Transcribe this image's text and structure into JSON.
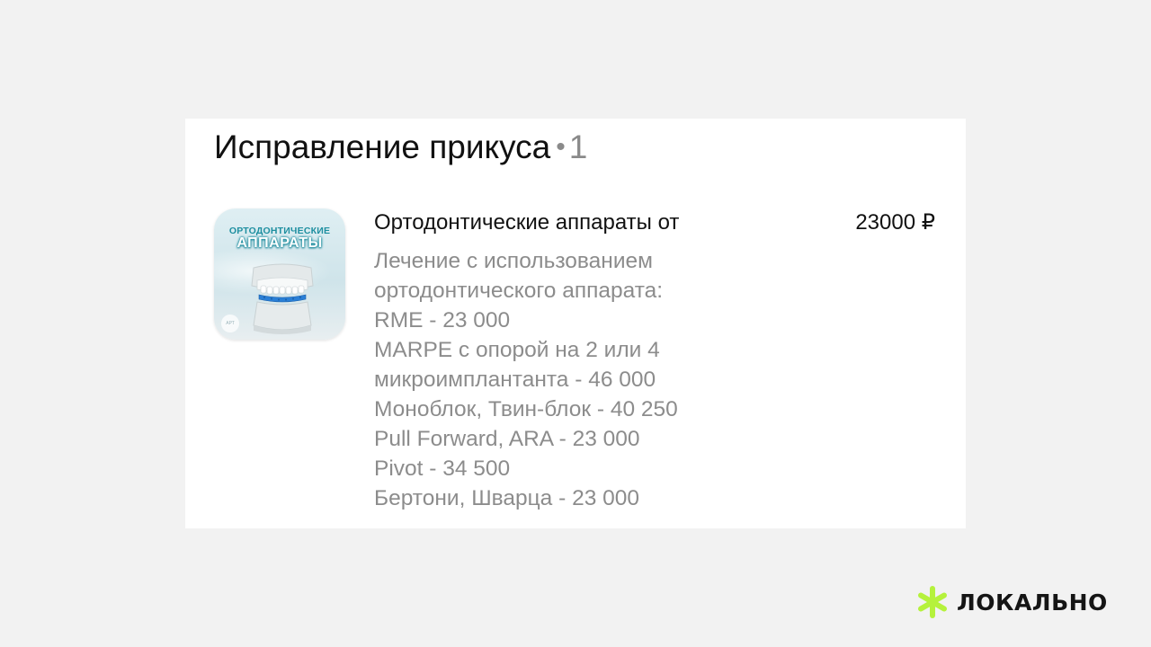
{
  "section": {
    "title": "Исправление прикуса",
    "separator": "•",
    "count": "1"
  },
  "service": {
    "image": {
      "line1": "ОРТОДОНТИЧЕСКИЕ",
      "line2": "АППАРАТЫ",
      "logo_text": "АРТ"
    },
    "name": "Ортодонтические аппараты от",
    "price": "23000 ₽",
    "description_lines": [
      "Лечение с использованием",
      "ортодонтического аппарата:",
      "RME - 23 000",
      "MARPE с опорой на 2 или 4",
      "микроимплантанта - 46 000",
      "Моноблок, Твин-блок - 40 250",
      "Pull Forward, ARA - 23 000",
      "Pivot - 34 500",
      "Бертони, Шварца - 23 000"
    ]
  },
  "brand": {
    "name": "ЛОКАЛЬНО",
    "icon": "asterisk-icon",
    "accent_color": "#b5f23c"
  },
  "colors": {
    "page_background": "#f2f2f2",
    "card_background": "#ffffff",
    "text_primary": "#111111",
    "text_secondary": "#8c8c8c"
  }
}
